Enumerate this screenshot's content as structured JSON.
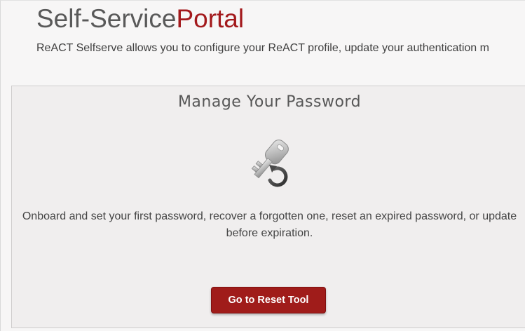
{
  "header": {
    "title_part1": "Self-Service",
    "title_part2": "Portal",
    "intro": "ReACT Selfserve allows you to configure your ReACT profile, update your authentication m"
  },
  "card": {
    "title": "Manage Your Password",
    "icon": "key-reset-icon",
    "description": "Onboard and set your first password, recover a forgotten one, reset an expired password, or update before expiration.",
    "button_label": "Go to Reset Tool"
  },
  "colors": {
    "accent": "#a3191c",
    "button": "#a01c1a",
    "title_gray": "#595959"
  }
}
